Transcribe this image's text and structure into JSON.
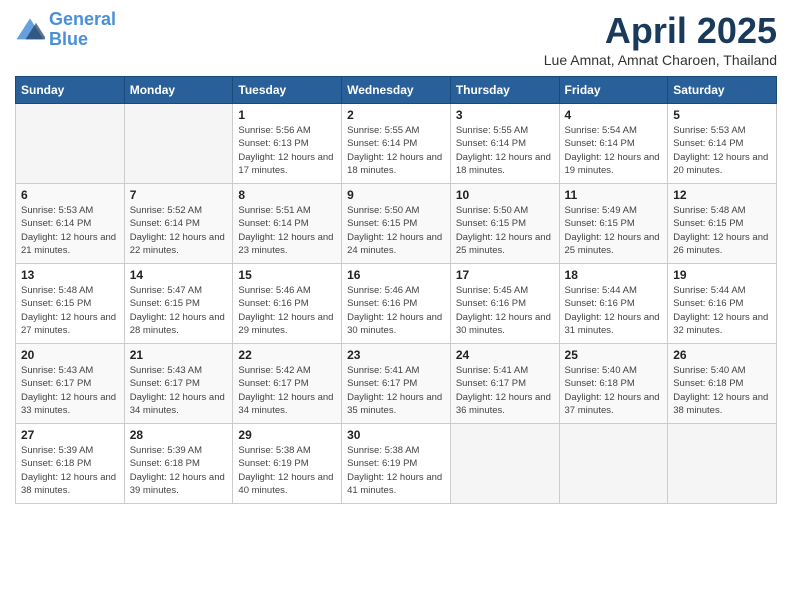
{
  "logo": {
    "line1": "General",
    "line2": "Blue"
  },
  "title": "April 2025",
  "subtitle": "Lue Amnat, Amnat Charoen, Thailand",
  "days_of_week": [
    "Sunday",
    "Monday",
    "Tuesday",
    "Wednesday",
    "Thursday",
    "Friday",
    "Saturday"
  ],
  "weeks": [
    [
      {
        "day": "",
        "info": ""
      },
      {
        "day": "",
        "info": ""
      },
      {
        "day": "1",
        "sunrise": "5:56 AM",
        "sunset": "6:13 PM",
        "daylight": "12 hours and 17 minutes."
      },
      {
        "day": "2",
        "sunrise": "5:55 AM",
        "sunset": "6:14 PM",
        "daylight": "12 hours and 18 minutes."
      },
      {
        "day": "3",
        "sunrise": "5:55 AM",
        "sunset": "6:14 PM",
        "daylight": "12 hours and 18 minutes."
      },
      {
        "day": "4",
        "sunrise": "5:54 AM",
        "sunset": "6:14 PM",
        "daylight": "12 hours and 19 minutes."
      },
      {
        "day": "5",
        "sunrise": "5:53 AM",
        "sunset": "6:14 PM",
        "daylight": "12 hours and 20 minutes."
      }
    ],
    [
      {
        "day": "6",
        "sunrise": "5:53 AM",
        "sunset": "6:14 PM",
        "daylight": "12 hours and 21 minutes."
      },
      {
        "day": "7",
        "sunrise": "5:52 AM",
        "sunset": "6:14 PM",
        "daylight": "12 hours and 22 minutes."
      },
      {
        "day": "8",
        "sunrise": "5:51 AM",
        "sunset": "6:14 PM",
        "daylight": "12 hours and 23 minutes."
      },
      {
        "day": "9",
        "sunrise": "5:50 AM",
        "sunset": "6:15 PM",
        "daylight": "12 hours and 24 minutes."
      },
      {
        "day": "10",
        "sunrise": "5:50 AM",
        "sunset": "6:15 PM",
        "daylight": "12 hours and 25 minutes."
      },
      {
        "day": "11",
        "sunrise": "5:49 AM",
        "sunset": "6:15 PM",
        "daylight": "12 hours and 25 minutes."
      },
      {
        "day": "12",
        "sunrise": "5:48 AM",
        "sunset": "6:15 PM",
        "daylight": "12 hours and 26 minutes."
      }
    ],
    [
      {
        "day": "13",
        "sunrise": "5:48 AM",
        "sunset": "6:15 PM",
        "daylight": "12 hours and 27 minutes."
      },
      {
        "day": "14",
        "sunrise": "5:47 AM",
        "sunset": "6:15 PM",
        "daylight": "12 hours and 28 minutes."
      },
      {
        "day": "15",
        "sunrise": "5:46 AM",
        "sunset": "6:16 PM",
        "daylight": "12 hours and 29 minutes."
      },
      {
        "day": "16",
        "sunrise": "5:46 AM",
        "sunset": "6:16 PM",
        "daylight": "12 hours and 30 minutes."
      },
      {
        "day": "17",
        "sunrise": "5:45 AM",
        "sunset": "6:16 PM",
        "daylight": "12 hours and 30 minutes."
      },
      {
        "day": "18",
        "sunrise": "5:44 AM",
        "sunset": "6:16 PM",
        "daylight": "12 hours and 31 minutes."
      },
      {
        "day": "19",
        "sunrise": "5:44 AM",
        "sunset": "6:16 PM",
        "daylight": "12 hours and 32 minutes."
      }
    ],
    [
      {
        "day": "20",
        "sunrise": "5:43 AM",
        "sunset": "6:17 PM",
        "daylight": "12 hours and 33 minutes."
      },
      {
        "day": "21",
        "sunrise": "5:43 AM",
        "sunset": "6:17 PM",
        "daylight": "12 hours and 34 minutes."
      },
      {
        "day": "22",
        "sunrise": "5:42 AM",
        "sunset": "6:17 PM",
        "daylight": "12 hours and 34 minutes."
      },
      {
        "day": "23",
        "sunrise": "5:41 AM",
        "sunset": "6:17 PM",
        "daylight": "12 hours and 35 minutes."
      },
      {
        "day": "24",
        "sunrise": "5:41 AM",
        "sunset": "6:17 PM",
        "daylight": "12 hours and 36 minutes."
      },
      {
        "day": "25",
        "sunrise": "5:40 AM",
        "sunset": "6:18 PM",
        "daylight": "12 hours and 37 minutes."
      },
      {
        "day": "26",
        "sunrise": "5:40 AM",
        "sunset": "6:18 PM",
        "daylight": "12 hours and 38 minutes."
      }
    ],
    [
      {
        "day": "27",
        "sunrise": "5:39 AM",
        "sunset": "6:18 PM",
        "daylight": "12 hours and 38 minutes."
      },
      {
        "day": "28",
        "sunrise": "5:39 AM",
        "sunset": "6:18 PM",
        "daylight": "12 hours and 39 minutes."
      },
      {
        "day": "29",
        "sunrise": "5:38 AM",
        "sunset": "6:19 PM",
        "daylight": "12 hours and 40 minutes."
      },
      {
        "day": "30",
        "sunrise": "5:38 AM",
        "sunset": "6:19 PM",
        "daylight": "12 hours and 41 minutes."
      },
      {
        "day": "",
        "info": ""
      },
      {
        "day": "",
        "info": ""
      },
      {
        "day": "",
        "info": ""
      }
    ]
  ],
  "labels": {
    "sunrise": "Sunrise:",
    "sunset": "Sunset:",
    "daylight": "Daylight:"
  }
}
